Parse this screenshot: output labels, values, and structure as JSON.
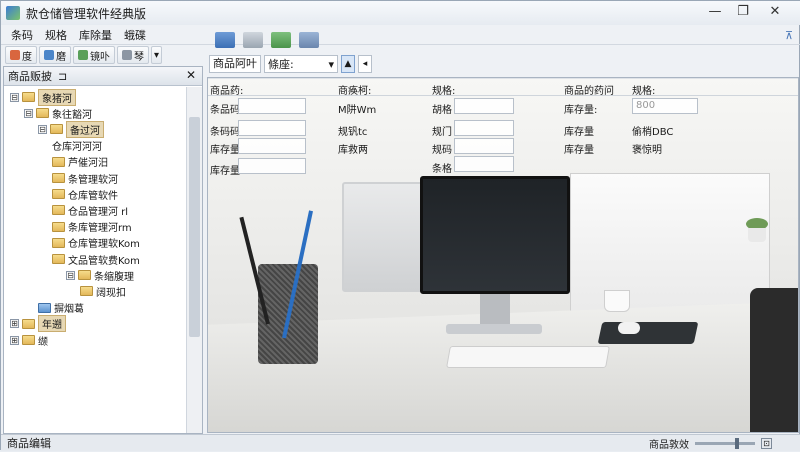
{
  "app": {
    "title": "款仓储管理软件经典版"
  },
  "window": {
    "minimize": "—",
    "maximize": "❐",
    "close": "✕"
  },
  "menu": {
    "items": [
      "条码",
      "规格",
      "库除量",
      "蛾碟"
    ]
  },
  "toolbar": {
    "buttons": [
      "度",
      "磨",
      "镜卟",
      "琴"
    ]
  },
  "left_panel": {
    "title": "商品贩披",
    "pin": "⊐",
    "close": "✕",
    "tree": [
      {
        "label": "象猪河",
        "level": 0,
        "expander": "⊟",
        "folder": "yellow",
        "selected": true
      },
      {
        "label": "象往豁河",
        "level": 1,
        "expander": "⊟",
        "folder": "yellow",
        "selected": false
      },
      {
        "label": "备过河",
        "level": 2,
        "expander": "⊟",
        "folder": "yellow",
        "selected": true
      },
      {
        "label": "仓库河河河",
        "level": 3,
        "expander": "",
        "folder": "",
        "selected": false
      },
      {
        "label": "芦催河汨",
        "level": 3,
        "expander": "",
        "folder": "yellow",
        "selected": false
      },
      {
        "label": "条管理软河",
        "level": 3,
        "expander": "",
        "folder": "yellow",
        "selected": false
      },
      {
        "label": "仓库管软件",
        "level": 3,
        "expander": "",
        "folder": "yellow",
        "selected": false
      },
      {
        "label": "仓品管理河 rl",
        "level": 3,
        "expander": "",
        "folder": "yellow",
        "selected": false
      },
      {
        "label": "条库管理河rm",
        "level": 3,
        "expander": "",
        "folder": "yellow",
        "selected": false
      },
      {
        "label": "仓库管理软Kom",
        "level": 3,
        "expander": "",
        "folder": "yellow",
        "selected": false
      },
      {
        "label": "文品管软费Kom",
        "level": 3,
        "expander": "",
        "folder": "yellow",
        "selected": false
      },
      {
        "label": "条缩腹理",
        "level": 4,
        "expander": "⊟",
        "folder": "yellow",
        "selected": false
      },
      {
        "label": "阔现扣",
        "level": 5,
        "expander": "",
        "folder": "yellow",
        "selected": false
      },
      {
        "label": "摒烟葛",
        "level": 2,
        "expander": "",
        "folder": "blue",
        "selected": false
      },
      {
        "label": "年遡",
        "level": 0,
        "expander": "⊞",
        "folder": "yellow",
        "selected": true
      },
      {
        "label": "缬",
        "level": 0,
        "expander": "⊞",
        "folder": "yellow",
        "selected": false
      }
    ]
  },
  "main_toolbar": {
    "pin_label": "⊼"
  },
  "filter": {
    "label": "商品阿叶",
    "select_value": "條座:",
    "select_arrow": "▾",
    "btn_up": "▲",
    "btn_down": "◂"
  },
  "form": {
    "headers": [
      "商品药:",
      "商痪柯:",
      "规格:",
      "商品的药问",
      "规格:"
    ],
    "rows": [
      [
        "条品码",
        "M阱Wm",
        "胡格",
        "库存量:",
        "800"
      ],
      [
        "条码码",
        "规钒tc",
        "规门",
        "库存量",
        "偷梢DBC"
      ],
      [
        "库存量",
        "库救两",
        "规码",
        "库存量",
        "褒惊明"
      ],
      [
        "库存量",
        "",
        "条格",
        "",
        ""
      ]
    ]
  },
  "status": {
    "left": "商品编辑",
    "right_label": "商品敦效",
    "box": "⊡"
  }
}
